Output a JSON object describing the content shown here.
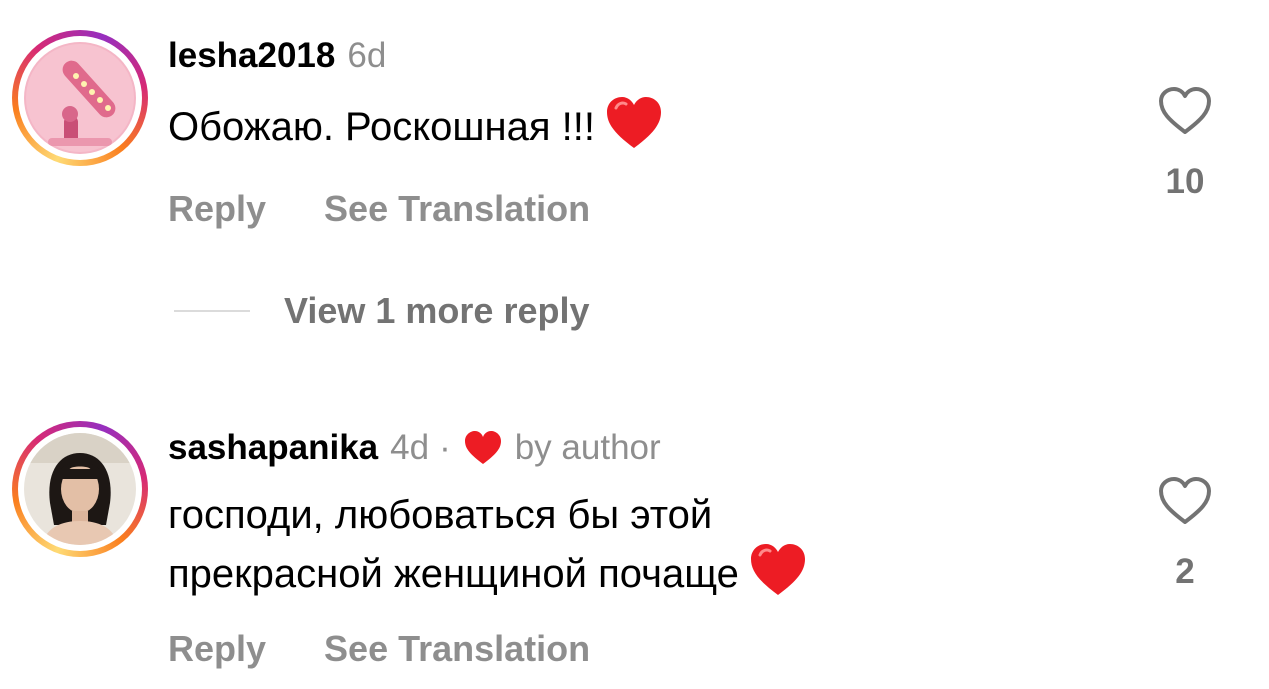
{
  "comments": [
    {
      "username": "lesha2018",
      "time": "6d",
      "text_lines": [
        "Обожаю. Роскошная !!!"
      ],
      "reply_label": "Reply",
      "translate_label": "See Translation",
      "likes": "10",
      "view_replies": "View 1 more reply",
      "avatar": "pink-lamp-avatar"
    },
    {
      "username": "sashapanika",
      "time": "4d",
      "separator": "·",
      "liked_by_author": "by author",
      "text_lines": [
        "господи, любоваться бы этой",
        "прекрасной женщиной почаще"
      ],
      "reply_label": "Reply",
      "translate_label": "See Translation",
      "likes": "2",
      "avatar": "woman-portrait-avatar"
    }
  ],
  "icons": {
    "like": "heart-outline-icon",
    "author_like": "heart-filled-icon",
    "emoji": "red-heart-emoji"
  },
  "colors": {
    "muted_text": "#8e8e8e",
    "heart_red": "#ed1c24",
    "story_ring": "#d62976"
  }
}
